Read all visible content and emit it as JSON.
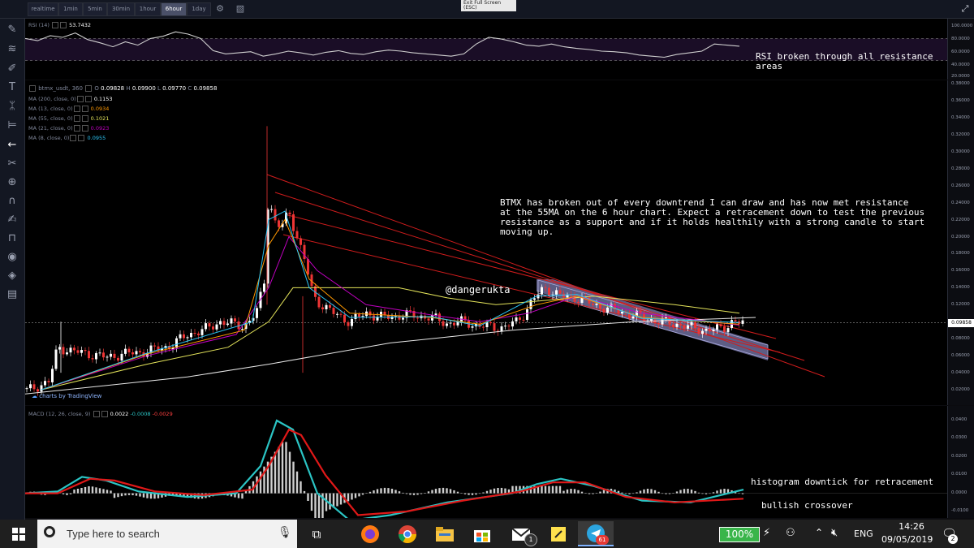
{
  "toolbar": {
    "intervals": [
      {
        "label": "realtime",
        "active": false
      },
      {
        "label": "1min",
        "active": false
      },
      {
        "label": "5min",
        "active": false
      },
      {
        "label": "30min",
        "active": false
      },
      {
        "label": "1hour",
        "active": false
      },
      {
        "label": "6hour",
        "active": true
      },
      {
        "label": "1day",
        "active": false
      }
    ],
    "icons": [
      "gear-icon",
      "image-icon"
    ],
    "exit_fullscreen_line1": "Exit Full Screen",
    "exit_fullscreen_line2": "(ESC)"
  },
  "sidebar": {
    "icons": [
      "crosshair-icon",
      "pencil-icon",
      "fib-icon",
      "brush-icon",
      "text-icon",
      "pattern-icon",
      "ruler-icon",
      "back-arrow-icon",
      "magnet-icon",
      "zoom-icon",
      "lock-drawings-icon",
      "lock-icon",
      "eye-icon",
      "layers-icon",
      "trash-icon"
    ]
  },
  "rsi": {
    "label": "RSI (14)",
    "value": "53.7432",
    "axis": [
      "100.0000",
      "80.0000",
      "60.0000",
      "40.0000",
      "20.0000"
    ],
    "values": [
      70,
      66,
      75,
      72,
      80,
      68,
      62,
      55,
      64,
      58,
      70,
      74,
      82,
      78,
      70,
      48,
      42,
      44,
      46,
      38,
      42,
      47,
      44,
      40,
      45,
      48,
      43,
      41,
      46,
      49,
      47,
      44,
      42,
      40,
      38,
      42,
      60,
      72,
      69,
      64,
      58,
      56,
      60,
      55,
      52,
      50,
      47,
      46,
      44,
      40,
      38,
      36,
      41,
      44,
      47,
      60,
      58,
      56
    ],
    "upper_band": 70,
    "lower_band": 30
  },
  "main": {
    "symbol": "btmx_usdt, 360",
    "ohlc": {
      "O": "0.09828",
      "H": "0.09900",
      "L": "0.09770",
      "C": "0.09858"
    },
    "mas": [
      {
        "label": "MA (200, close, 0)",
        "value": "0.1153",
        "color": "#ffffff"
      },
      {
        "label": "MA (13, close, 0)",
        "value": "0.0934",
        "color": "#ff9800"
      },
      {
        "label": "MA (55, close, 0)",
        "value": "0.1021",
        "color": "#e3e35a"
      },
      {
        "label": "MA (21, close, 0)",
        "value": "0.0923",
        "color": "#c000c0"
      },
      {
        "label": "MA (8, close, 0)",
        "value": "0.0955",
        "color": "#2bc4f5"
      }
    ],
    "axis": [
      "0.38000",
      "0.36000",
      "0.34000",
      "0.32000",
      "0.30000",
      "0.28000",
      "0.26000",
      "0.24000",
      "0.22000",
      "0.20000",
      "0.18000",
      "0.16000",
      "0.14000",
      "0.12000",
      "0.10000",
      "0.08000",
      "0.06000",
      "0.04000",
      "0.02000"
    ],
    "price_tag": "0.09858",
    "price_tag_value": 0.09858,
    "watermark": "charts by TradingView"
  },
  "macd": {
    "label": "MACD (12, 26, close, 9)",
    "v1": "0.0022",
    "v2": "-0.0008",
    "v3": "-0.0029",
    "axis": [
      "0.0400",
      "0.0300",
      "0.0200",
      "0.0100",
      "0.0000",
      "-0.0100"
    ]
  },
  "annotations": {
    "rsi_note_line1": "RSI broken through all resistance",
    "rsi_note_line2": "areas",
    "main_note_lines": [
      "BTMX has broken out of every downtrend I can draw and has now met resistance",
      "at the 55MA on the 6 hour chart. Expect a retracement down to test the previous",
      "resistance as a support and if it holds healthily with a strong candle to start",
      "moving up."
    ],
    "author": "@dangerukta",
    "histogram_note": "histogram downtick for retracement",
    "crossover_note": "bullish crossover"
  },
  "taskbar": {
    "search_placeholder": "Type here to search",
    "battery": "100%",
    "language": "ENG",
    "time": "14:26",
    "date": "09/05/2019",
    "mail_badge": "1",
    "telegram_badge": "61",
    "notification_badge": "2",
    "apps": [
      "firefox-icon",
      "chrome-icon",
      "file-explorer-icon",
      "store-icon",
      "mail-icon",
      "sticky-notes-icon",
      "telegram-icon"
    ]
  }
}
